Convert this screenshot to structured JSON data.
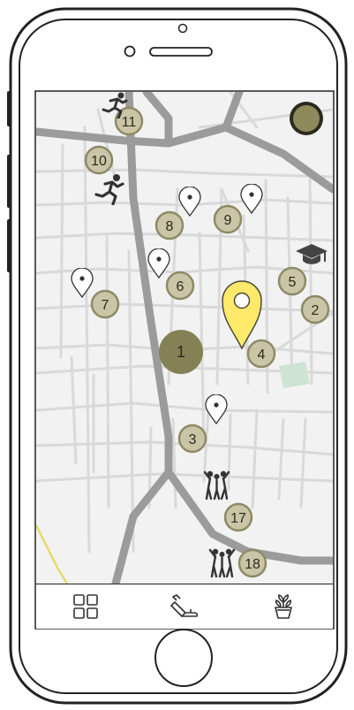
{
  "colors": {
    "marker_fill": "#c9c5a6",
    "marker_border": "#8e8a66",
    "cluster_fill": "#868155",
    "pin_yellow": "#ffe96a",
    "road_major": "#9b9b9b",
    "road_minor": "#d8d8d8",
    "map_bg": "#f2f2f2",
    "park_green": "#cfe3d5"
  },
  "map": {
    "cluster_label": "1",
    "markers": [
      "2",
      "3",
      "4",
      "5",
      "6",
      "7",
      "8",
      "9",
      "10",
      "11",
      "17",
      "18"
    ],
    "icons": [
      "runner-icon",
      "runner-icon",
      "graduation-cap-icon",
      "people-group-icon",
      "people-group-icon"
    ],
    "pins": [
      "location-pin-icon",
      "location-pin-icon",
      "location-pin-icon",
      "location-pin-icon",
      "location-pin-icon"
    ],
    "selected_pin": "selected-location-pin"
  },
  "tabbar": {
    "tabs": [
      "grid-icon",
      "watering-can-icon",
      "potted-plant-icon"
    ]
  }
}
